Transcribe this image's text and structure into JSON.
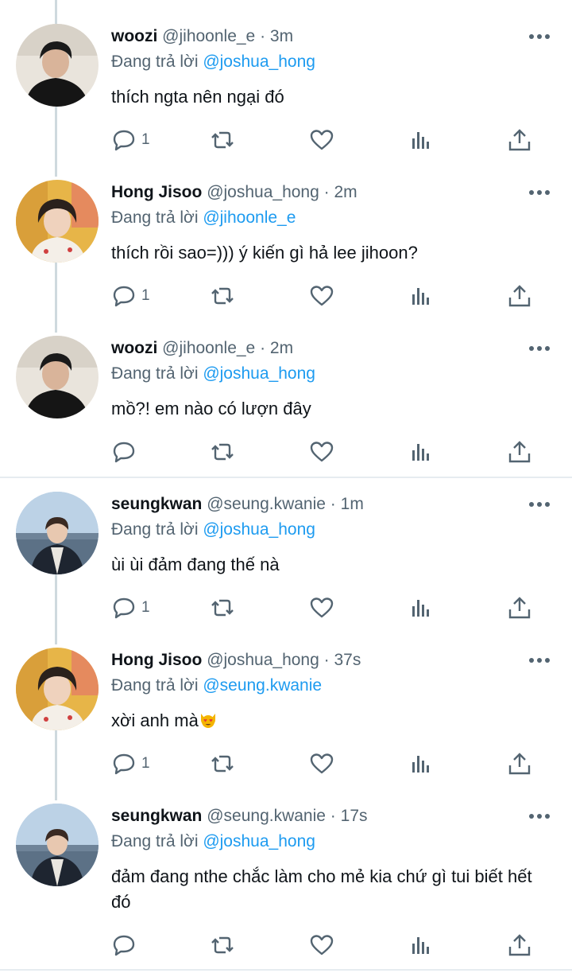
{
  "tweets": [
    {
      "name": "woozi",
      "handle": "@jihoonle_e",
      "time": "3m",
      "reply_prefix": "Đang trả lời",
      "reply_to": "@joshua_hong",
      "text": "thích ngta nên ngại đó",
      "replies": "1",
      "avatar": "woozi"
    },
    {
      "name": "Hong Jisoo",
      "handle": "@joshua_hong",
      "time": "2m",
      "reply_prefix": "Đang trả lời",
      "reply_to": "@jihoonle_e",
      "text": "thích rồi sao=))) ý kiến gì hả lee jihoon?",
      "replies": "1",
      "avatar": "jisoo"
    },
    {
      "name": "woozi",
      "handle": "@jihoonle_e",
      "time": "2m",
      "reply_prefix": "Đang trả lời",
      "reply_to": "@joshua_hong",
      "text": "mồ?! em nào có lượn đây",
      "replies": "",
      "avatar": "woozi"
    },
    {
      "name": "seungkwan",
      "handle": "@seung.kwanie",
      "time": "1m",
      "reply_prefix": "Đang trả lời",
      "reply_to": "@joshua_hong",
      "text": "ùi ùi đảm đang thế nà",
      "replies": "1",
      "avatar": "seungkwan"
    },
    {
      "name": "Hong Jisoo",
      "handle": "@joshua_hong",
      "time": "37s",
      "reply_prefix": "Đang trả lời",
      "reply_to": "@seung.kwanie",
      "text": "xời anh mà",
      "replies": "1",
      "avatar": "jisoo"
    },
    {
      "name": "seungkwan",
      "handle": "@seung.kwanie",
      "time": "17s",
      "reply_prefix": "Đang trả lời",
      "reply_to": "@joshua_hong",
      "text": "đảm đang nthe chắc làm cho mẻ kia chứ gì tui biết hết đó",
      "replies": "",
      "avatar": "seungkwan"
    }
  ],
  "separator": " · ",
  "icons": {
    "more": "more-dots-icon",
    "reply": "reply-bubble-icon",
    "retweet": "retweet-icon",
    "like": "heart-icon",
    "analytics": "analytics-icon",
    "share": "share-icon",
    "emoji": "heart-eyes-cat-emoji"
  },
  "colors": {
    "link": "#1d9bf0",
    "secondary": "#536471",
    "text": "#0f1419",
    "thread_line": "#cfd9de"
  }
}
